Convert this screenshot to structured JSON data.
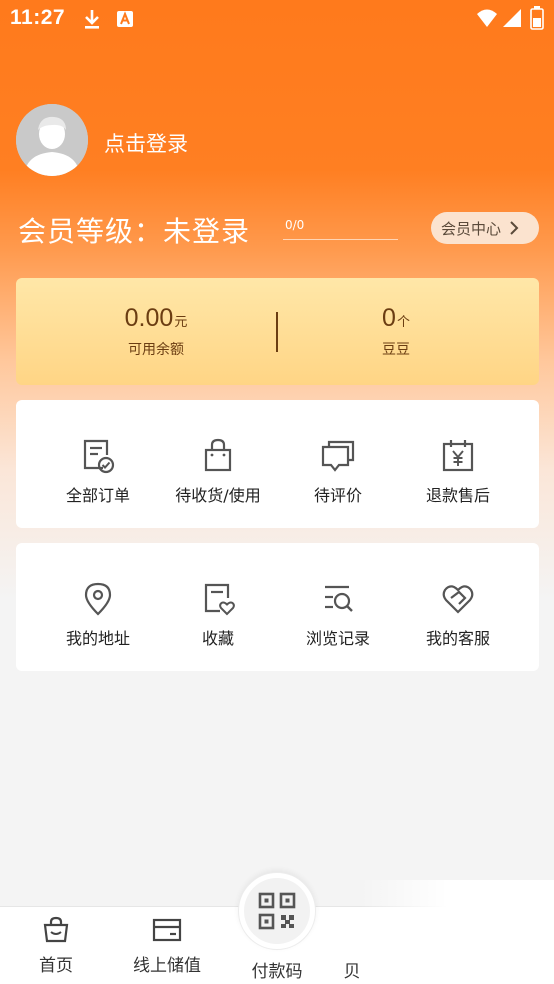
{
  "status_bar": {
    "time": "11:27"
  },
  "profile": {
    "login_text": "点击登录"
  },
  "member": {
    "level_text": "会员等级：未登录",
    "progress_text": "0/0",
    "progress_fraction": 0,
    "center_button": "会员中心"
  },
  "balance": {
    "available": {
      "value": "0.00",
      "unit": "元",
      "label": "可用余额"
    },
    "beans": {
      "value": "0",
      "unit": "个",
      "label": "豆豆"
    }
  },
  "orders": [
    {
      "label": "全部订单",
      "icon": "order-doc-check-icon"
    },
    {
      "label": "待收货/使用",
      "icon": "shopping-bag-icon"
    },
    {
      "label": "待评价",
      "icon": "comment-icon"
    },
    {
      "label": "退款售后",
      "icon": "calendar-yen-icon"
    }
  ],
  "services": [
    {
      "label": "我的地址",
      "icon": "location-pin-icon"
    },
    {
      "label": "收藏",
      "icon": "doc-heart-icon"
    },
    {
      "label": "浏览记录",
      "icon": "list-search-icon"
    },
    {
      "label": "我的客服",
      "icon": "heart-handshake-icon"
    }
  ],
  "bottom_nav": [
    {
      "label": "首页",
      "icon": "shopping-basket-icon"
    },
    {
      "label": "线上储值",
      "icon": "wallet-card-icon"
    },
    {
      "label": "付款码",
      "icon": "qr-code-icon"
    },
    {
      "label": "贝",
      "icon": ""
    }
  ],
  "colors": {
    "accent": "#ff7a1c",
    "card_gold": "#ffd585",
    "text_brown": "#6b3d12"
  }
}
